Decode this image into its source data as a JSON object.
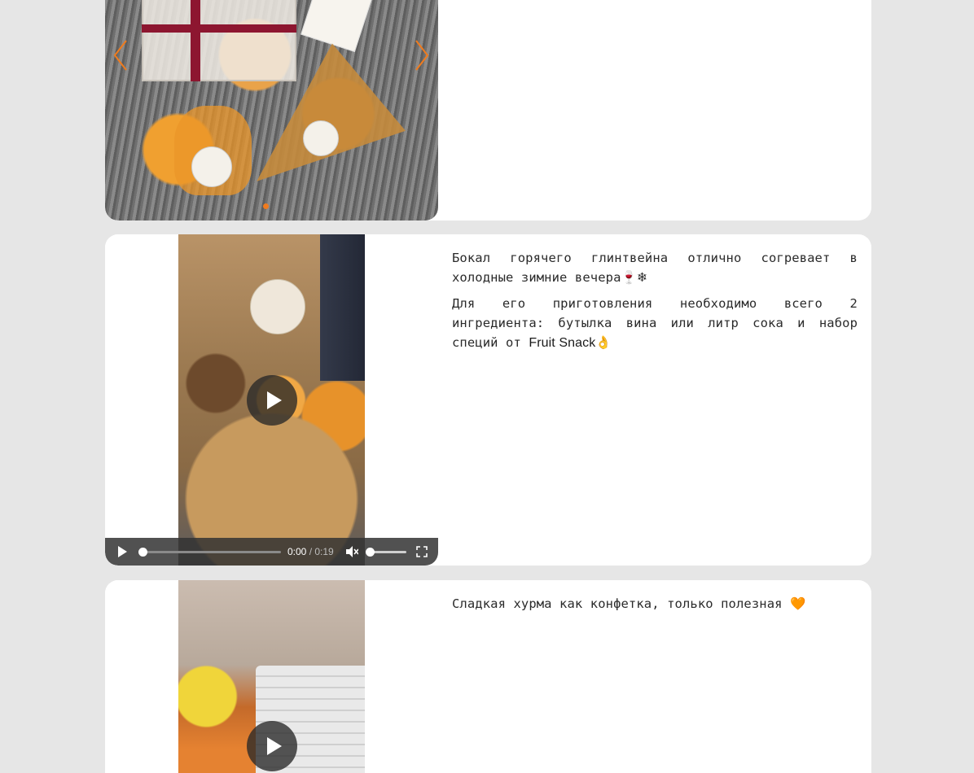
{
  "post1": {
    "has_arrows": true,
    "slider_dots": 1,
    "accent_color": "#f07b1d"
  },
  "post2": {
    "paragraph1_text": "Бокал горячего глинтвейна отлично согревает в холодные зимние вечера",
    "paragraph1_emoji": "🍷❄",
    "paragraph2_text": "Для его приготовления необходимо всего 2 ингредиента: бутылка вина или литр сока и набор специй от ",
    "brand": "Fruit Snack",
    "paragraph2_emoji": "👌",
    "video": {
      "current_time": "0:00",
      "separator": " / ",
      "duration": "0:19",
      "progress": 0,
      "volume": 0,
      "muted": true
    }
  },
  "post3": {
    "text": "Сладкая хурма как конфетка, только полезная ",
    "emoji": "🧡"
  }
}
